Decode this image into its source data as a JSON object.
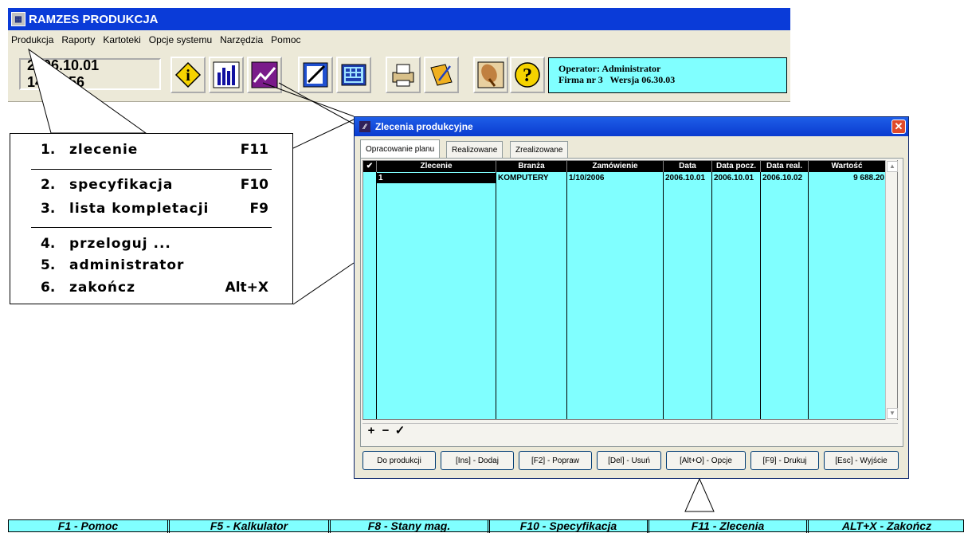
{
  "app": {
    "title": "RAMZES PRODUKCJA"
  },
  "menu": [
    "Produkcja",
    "Raporty",
    "Kartoteki",
    "Opcje systemu",
    "Narzędzia",
    "Pomoc"
  ],
  "toolbar": {
    "clock": "2006.10.01 14:56:56",
    "icons": [
      "info-icon",
      "bar-chart-icon",
      "line-chart-icon",
      "edit-form-icon",
      "calculator-icon",
      "printer-icon",
      "notebook-icon",
      "satellite-icon",
      "help-icon"
    ],
    "operator_line": "Operator: Administrator",
    "firm_line": "Firma nr 3   Wersja 06.30.03"
  },
  "popup_menu": {
    "items": [
      {
        "num": "1.",
        "label": "zlecenie",
        "key": "F11"
      },
      {
        "num": "2.",
        "label": "specyfikacja",
        "key": "F10"
      },
      {
        "num": "3.",
        "label": "lista kompletacji",
        "key": "F9"
      },
      {
        "num": "4.",
        "label": "przeloguj ...",
        "key": ""
      },
      {
        "num": "5.",
        "label": "administrator",
        "key": ""
      },
      {
        "num": "6.",
        "label": "zakończ",
        "key": "Alt+X"
      }
    ]
  },
  "dialog": {
    "title": "Zlecenia produkcyjne",
    "close": "✕",
    "tabs": [
      "Opracowanie planu",
      "Realizowane",
      "Zrealizowane"
    ],
    "columns": [
      "✔",
      "Zlecenie",
      "Branża",
      "Zamówienie",
      "Data",
      "Data pocz.",
      "Data real.",
      "Wartość"
    ],
    "rows": [
      {
        "check": "",
        "zlecenie": "1",
        "branza": "KOMPUTERY",
        "zamowienie": "1/10/2006",
        "data": "2006.10.01",
        "data_pocz": "2006.10.01",
        "data_real": "2006.10.02",
        "wartosc": "9 688.20"
      }
    ],
    "nav": [
      "+",
      "−",
      "✓"
    ],
    "buttons": [
      "Do produkcji",
      "[Ins] - Dodaj",
      "[F2] - Popraw",
      "[Del] - Usuń",
      "[Alt+O] - Opcje",
      "[F9] - Drukuj",
      "[Esc] - Wyjście"
    ]
  },
  "keybar": [
    "F1 - Pomoc",
    "F5 - Kalkulator",
    "F8 -  Stany mag.",
    "F10 - Specyfikacja",
    "F11 - Zlecenia",
    "ALT+X - Zakończ"
  ],
  "colors": {
    "title_blue": "#0a3bd8",
    "cyan": "#80ffff",
    "window_bg": "#ece9d8"
  }
}
